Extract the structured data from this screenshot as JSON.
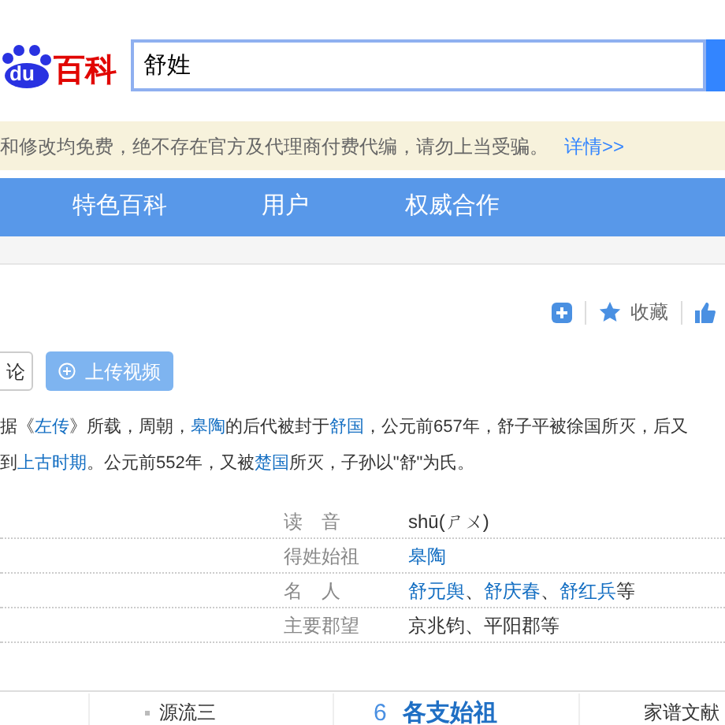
{
  "logo": {
    "mark": "du",
    "text": "百科"
  },
  "search": {
    "value": "舒姓"
  },
  "notice": {
    "text": "和修改均免费，绝不存在官方及代理商付费代编，请勿上当受骗。",
    "link": "详情>>"
  },
  "nav": [
    "特色百科",
    "用户",
    "权威合作"
  ],
  "actions": [
    {
      "kind": "add"
    },
    {
      "kind": "star",
      "label": "收藏"
    },
    {
      "kind": "like"
    }
  ],
  "buttons": [
    {
      "kind": "plain",
      "label": "论"
    },
    {
      "kind": "upload",
      "label": "上传视频"
    }
  ],
  "paragraph_lines": [
    [
      {
        "kind": "text",
        "text": "据《"
      },
      {
        "kind": "link",
        "text": "左传"
      },
      {
        "kind": "text",
        "text": "》所载，周朝，"
      },
      {
        "kind": "link",
        "text": "皋陶"
      },
      {
        "kind": "text",
        "text": "的后代被封于"
      },
      {
        "kind": "link",
        "text": "舒国"
      },
      {
        "kind": "text",
        "text": "，公元前657年，舒子平被徐国所灭，后又"
      }
    ],
    [
      {
        "kind": "text",
        "text": "到"
      },
      {
        "kind": "link",
        "text": "上古时期"
      },
      {
        "kind": "text",
        "text": "。公元前552年，又被"
      },
      {
        "kind": "link",
        "text": "楚国"
      },
      {
        "kind": "text",
        "text": "所灭，子孙以\"舒\"为氏。"
      }
    ]
  ],
  "info": [
    {
      "label": "读　音",
      "value": [
        {
          "kind": "text",
          "text": "shū(ㄕㄨ)"
        }
      ]
    },
    {
      "label": "得姓始祖",
      "value": [
        {
          "kind": "link",
          "text": "皋陶"
        }
      ]
    },
    {
      "label": "名　人",
      "value": [
        {
          "kind": "link",
          "text": "舒元舆"
        },
        {
          "kind": "text",
          "text": "、"
        },
        {
          "kind": "link",
          "text": "舒庆春"
        },
        {
          "kind": "text",
          "text": "、"
        },
        {
          "kind": "link",
          "text": "舒红兵"
        },
        {
          "kind": "text",
          "text": "等"
        }
      ]
    },
    {
      "label": "主要郡望",
      "value": [
        {
          "kind": "text",
          "text": "京兆钧、平阳郡等"
        }
      ]
    }
  ],
  "catalog": {
    "item": "源流三",
    "number": "6",
    "heading": "各支始祖",
    "side_item": "家谱文献"
  }
}
